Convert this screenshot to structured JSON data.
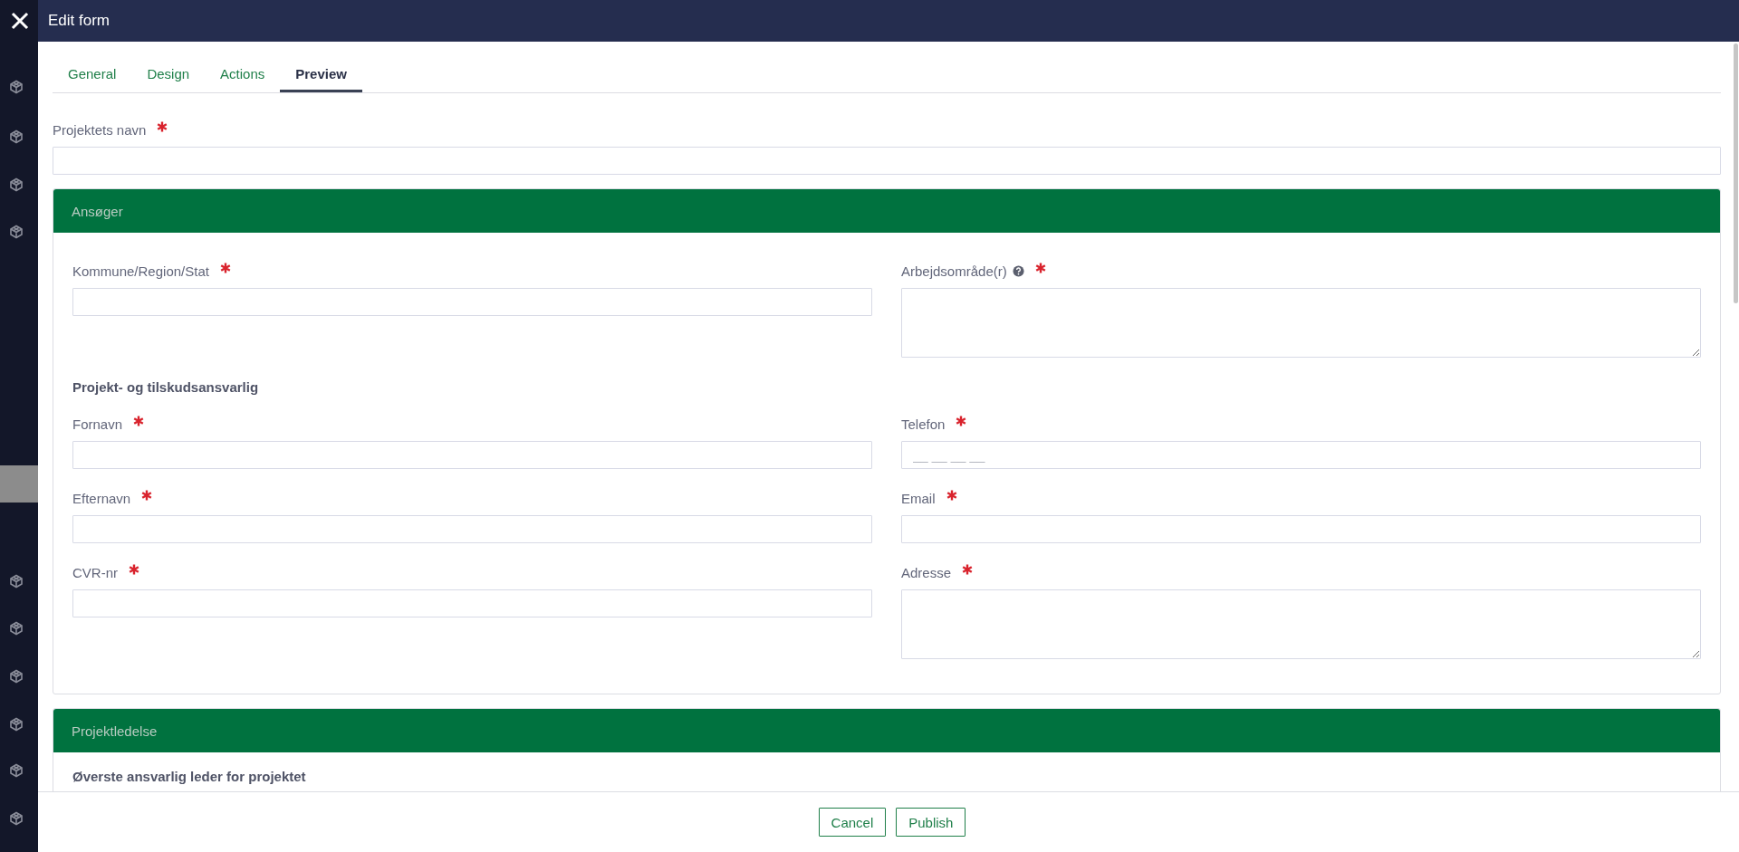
{
  "window": {
    "title": "Edit form"
  },
  "tabs": [
    {
      "label": "General",
      "selected": false
    },
    {
      "label": "Design",
      "selected": false
    },
    {
      "label": "Actions",
      "selected": false
    },
    {
      "label": "Preview",
      "selected": true
    }
  ],
  "top_field": {
    "label": "Projektets navn",
    "required": true,
    "kind": "input"
  },
  "sections": [
    {
      "title": "Ansøger",
      "rows": [
        {
          "cells": [
            {
              "kind": "input",
              "label": "Kommune/Region/Stat",
              "required": true
            },
            {
              "kind": "textarea",
              "label": "Arbejdsområde(r)",
              "required": true,
              "help": true
            }
          ]
        },
        {
          "cells": [
            {
              "kind": "heading",
              "label": "Projekt- og tilskudsansvarlig"
            }
          ]
        },
        {
          "cells": [
            {
              "kind": "input",
              "label": "Fornavn",
              "required": true
            },
            {
              "kind": "input",
              "label": "Telefon",
              "required": true,
              "placeholder": "__ __ __ __"
            }
          ]
        },
        {
          "cells": [
            {
              "kind": "input",
              "label": "Efternavn",
              "required": true
            },
            {
              "kind": "input",
              "label": "Email",
              "required": true
            }
          ]
        },
        {
          "cells": [
            {
              "kind": "input",
              "label": "CVR-nr",
              "required": true
            },
            {
              "kind": "textarea",
              "label": "Adresse",
              "required": true
            }
          ]
        }
      ]
    },
    {
      "title": "Projektledelse",
      "rows": [
        {
          "cells": [
            {
              "kind": "heading",
              "label": "Øverste ansvarlig leder for projektet"
            }
          ]
        }
      ]
    }
  ],
  "buttons": [
    "Cancel",
    "Publish"
  ]
}
